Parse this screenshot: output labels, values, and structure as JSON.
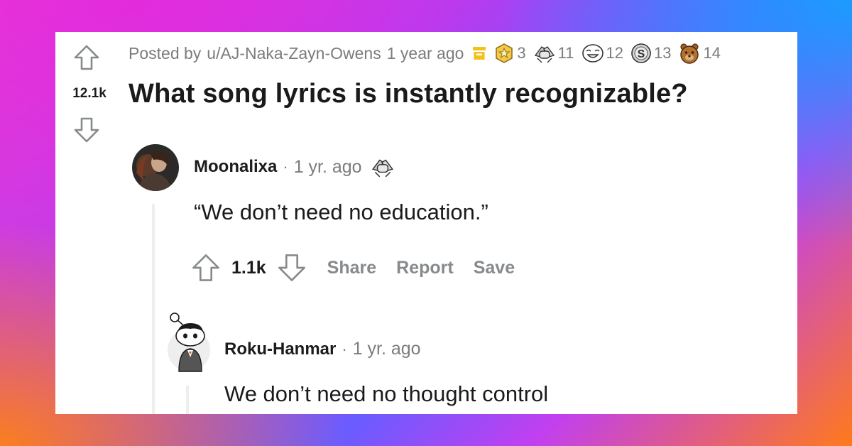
{
  "post": {
    "posted_by_prefix": "Posted by",
    "author": "u/AJ-Naka-Zayn-Owens",
    "age": "1 year ago",
    "score": "12.1k",
    "title": "What song lyrics is instantly recognizable?",
    "awards": [
      {
        "icon": "star-award-icon",
        "count": "3"
      },
      {
        "icon": "hands-award-icon",
        "count": "11"
      },
      {
        "icon": "laughing-face-award-icon",
        "count": "12"
      },
      {
        "icon": "silver-coin-award-icon",
        "count": "13"
      },
      {
        "icon": "bear-award-icon",
        "count": "14"
      }
    ]
  },
  "comment1": {
    "author": "Moonalixa",
    "dot": "·",
    "age": "1 yr. ago",
    "award_icon": "hands-award-icon",
    "body": "“We don’t need no education.”",
    "score": "1.1k",
    "actions": {
      "share": "Share",
      "report": "Report",
      "save": "Save"
    }
  },
  "comment2": {
    "author": "Roku-Hanmar",
    "dot": "·",
    "age": "1 yr. ago",
    "body": "We don’t need no thought control"
  },
  "colors": {
    "accent_yellow": "#f2c21b",
    "text_dark": "#1a1a1b",
    "text_muted": "#7c7c7c",
    "action_gray": "#878a8c"
  }
}
